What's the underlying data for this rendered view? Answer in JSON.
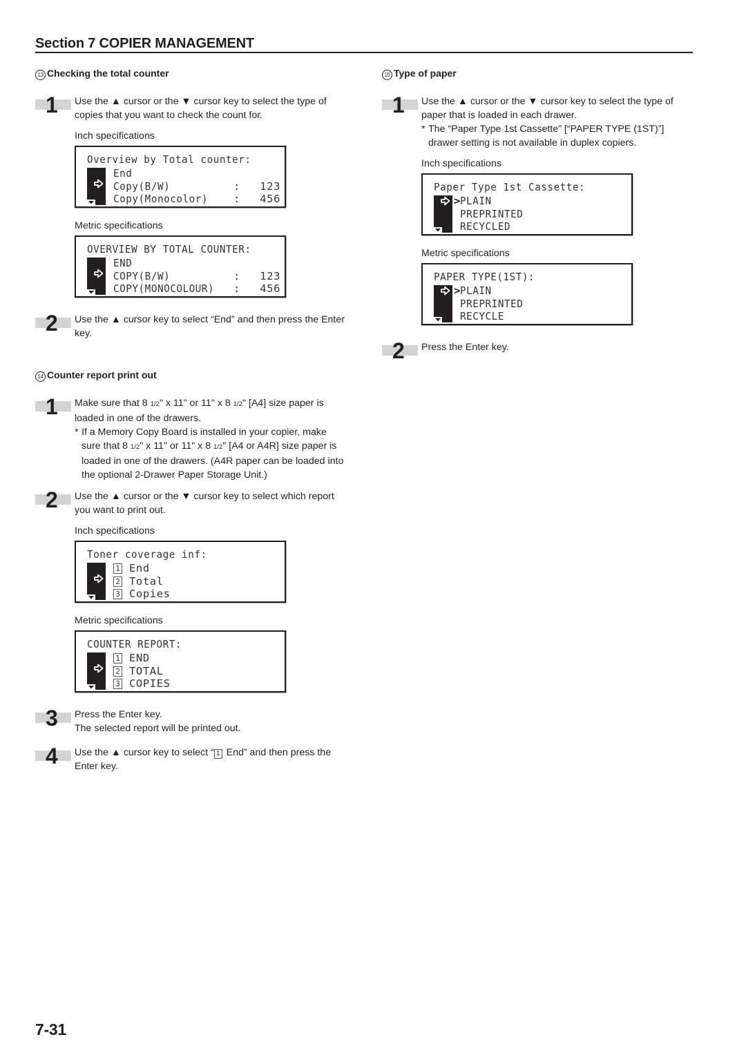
{
  "header": {
    "section_title": "Section 7  COPIER MANAGEMENT"
  },
  "left_column": {
    "section13": {
      "number": "13",
      "title": "Checking the total counter",
      "step1": {
        "number": "1",
        "text": "Use the ▲ cursor or the ▼ cursor key to select the type of copies that you want to check the count for."
      },
      "inch_label": "Inch specifications",
      "inch_display": {
        "title": "Overview by Total counter:",
        "rows": [
          {
            "label": "End",
            "colon": "",
            "value": ""
          },
          {
            "label": "Copy(B/W)",
            "colon": ":",
            "value": "123"
          },
          {
            "label": "Copy(Monocolor)",
            "colon": ":",
            "value": "456"
          }
        ],
        "selected_index": 1
      },
      "metric_label": "Metric specifications",
      "metric_display": {
        "title": "OVERVIEW BY TOTAL COUNTER:",
        "rows": [
          {
            "label": "END",
            "colon": "",
            "value": ""
          },
          {
            "label": "COPY(B/W)",
            "colon": ":",
            "value": "123"
          },
          {
            "label": "COPY(MONOCOLOUR)",
            "colon": ":",
            "value": "456"
          }
        ],
        "selected_index": 1
      },
      "step2": {
        "number": "2",
        "text": "Use the ▲ cursor key to select “End” and then press the Enter key."
      }
    },
    "section14": {
      "number": "14",
      "title": "Counter report print out",
      "step1": {
        "number": "1",
        "text_a": "Make sure that 8 ",
        "frac": "1/2",
        "text_b": "\" x 11\" or 11\" x 8 ",
        "text_c": "\" [A4] size paper is loaded in one of the drawers.",
        "note_star": "*",
        "note_a": "If a Memory Copy Board is installed in your copier, make sure that 8 ",
        "note_b": "\" x 11\" or 11\" x 8 ",
        "note_c": "\" [A4 or A4R] size paper is loaded in one of the drawers. (A4R paper can be loaded into the optional 2-Drawer Paper Storage Unit.)"
      },
      "step2": {
        "number": "2",
        "text": "Use the ▲ cursor or the ▼ cursor key to select which report you want to print out."
      },
      "inch_label": "Inch specifications",
      "inch_display": {
        "title": "Toner coverage inf:",
        "rows": [
          {
            "num": "1",
            "label": "End"
          },
          {
            "num": "2",
            "label": "Total"
          },
          {
            "num": "3",
            "label": "Copies"
          }
        ],
        "selected_index": 1
      },
      "metric_label": "Metric specifications",
      "metric_display": {
        "title": "COUNTER REPORT:",
        "rows": [
          {
            "num": "1",
            "label": "END"
          },
          {
            "num": "2",
            "label": "TOTAL"
          },
          {
            "num": "3",
            "label": "COPIES"
          }
        ],
        "selected_index": 1
      },
      "step3": {
        "number": "3",
        "line1": "Press the Enter key.",
        "line2": "The selected report will be printed out."
      },
      "step4": {
        "number": "4",
        "text_a": "Use the ▲ cursor key to select “",
        "box": "1",
        "text_b": " End” and then press the Enter key."
      }
    }
  },
  "right_column": {
    "section15": {
      "number": "15",
      "title": "Type of paper",
      "step1": {
        "number": "1",
        "text": "Use the ▲ cursor or the ▼ cursor key to select the type of paper that is loaded in each drawer.",
        "note_star": "*",
        "note": "The “Paper Type 1st Cassette” [“PAPER TYPE (1ST)”] drawer setting is not available in duplex copiers."
      },
      "inch_label": "Inch specifications",
      "inch_display": {
        "title": "Paper Type 1st Cassette:",
        "rows": [
          {
            "label": "PLAIN",
            "caret": ">"
          },
          {
            "label": "PREPRINTED",
            "caret": ""
          },
          {
            "label": "RECYCLED",
            "caret": ""
          }
        ],
        "selected_index": 0
      },
      "metric_label": "Metric specifications",
      "metric_display": {
        "title": "PAPER TYPE(1ST):",
        "rows": [
          {
            "label": "PLAIN",
            "caret": ">"
          },
          {
            "label": "PREPRINTED",
            "caret": ""
          },
          {
            "label": "RECYCLE",
            "caret": ""
          }
        ],
        "selected_index": 0
      },
      "step2": {
        "number": "2",
        "text": "Press the Enter key."
      }
    }
  },
  "footer": {
    "page_number": "7-31"
  },
  "icons": {
    "select_arrow": "right-arrow-icon",
    "scroll_down": "triangle-down-icon"
  }
}
